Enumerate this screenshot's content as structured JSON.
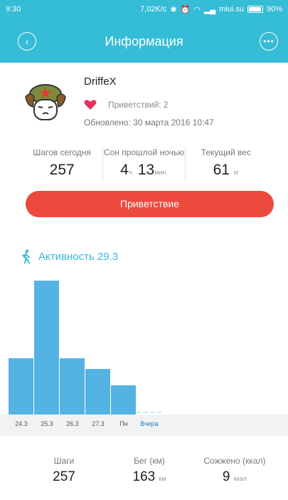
{
  "status_bar": {
    "time": "9:30",
    "speed": "7,02K/c",
    "carrier": "miui.su",
    "battery": "90%"
  },
  "header": {
    "title": "Информация"
  },
  "profile": {
    "name": "DriffeX",
    "greetings_label": "Приветствий: 2",
    "updated_label": "Обновлено: 30 марта 2016 10:47"
  },
  "stats": {
    "steps": {
      "label": "Шагов сегодня",
      "value": "257"
    },
    "sleep": {
      "label": "Сон прошлой ночью",
      "hours": "4",
      "hours_unit": "ч.",
      "minutes": "13",
      "minutes_unit": "мин."
    },
    "weight": {
      "label": "Текущий вес",
      "value": "61",
      "unit": "кг"
    }
  },
  "greet_button": {
    "label": "Приветствие"
  },
  "activity": {
    "label": "Активность 29.3"
  },
  "activity_chart": {
    "days": [
      "24.3",
      "25.3",
      "26.3",
      "27.3",
      "Пн",
      "Вчера"
    ],
    "levels": [
      0.42,
      1.0,
      0.42,
      0.34,
      0.22,
      0.02
    ],
    "bar_color": "#55b3e3"
  },
  "bottom_stats": {
    "steps": {
      "label": "Шаги",
      "value": "257"
    },
    "run": {
      "label": "Бег (км)",
      "value": "163",
      "unit": "км"
    },
    "burned": {
      "label": "Сожжено (ккал)",
      "value": "9",
      "unit": "ккал"
    }
  },
  "colors": {
    "accent": "#35bcd6",
    "button": "#ec4a3d",
    "heart": "#e8325a"
  },
  "icons": {
    "back": "chevron-left-icon",
    "more": "more-dots-icon",
    "heart": "heart-icon",
    "activity": "walking-person-icon",
    "avatar": "mi-bunny-avatar"
  }
}
